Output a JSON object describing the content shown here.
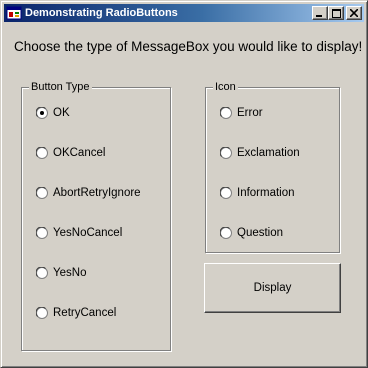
{
  "window": {
    "title": "Demonstrating RadioButtons"
  },
  "prompt": "Choose the type of MessageBox you would like to display!",
  "button_type_group": {
    "label": "Button Type",
    "options": [
      "OK",
      "OKCancel",
      "AbortRetryIgnore",
      "YesNoCancel",
      "YesNo",
      "RetryCancel"
    ],
    "selected": "OK"
  },
  "icon_group": {
    "label": "Icon",
    "options": [
      "Error",
      "Exclamation",
      "Information",
      "Question"
    ],
    "selected": null
  },
  "display_button": {
    "label": "Display"
  },
  "colors": {
    "face": "#d4d0c8",
    "titlebar_start": "#0a246a",
    "titlebar_end": "#a6caf0"
  }
}
